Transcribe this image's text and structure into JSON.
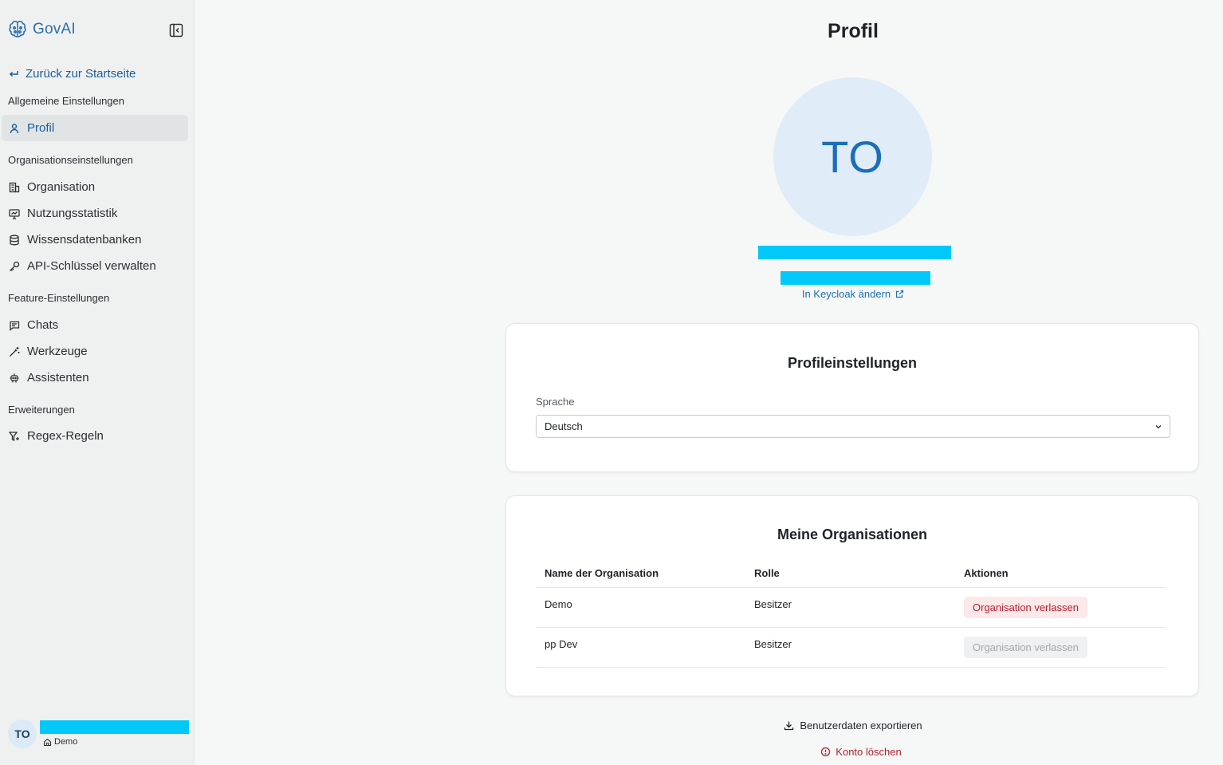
{
  "app": {
    "name": "GovAI"
  },
  "sidebar": {
    "back_label": "Zurück zur Startseite",
    "sections": {
      "general": "Allgemeine Einstellungen",
      "organization": "Organisationseinstellungen",
      "features": "Feature-Einstellungen",
      "extensions": "Erweiterungen"
    },
    "items": {
      "profile": "Profil",
      "organisation": "Organisation",
      "usage": "Nutzungsstatistik",
      "knowledge": "Wissensdatenbanken",
      "api_keys": "API-Schlüssel verwalten",
      "chats": "Chats",
      "tools": "Werkzeuge",
      "assistants": "Assistenten",
      "regex": "Regex-Regeln"
    },
    "user": {
      "initials": "TO",
      "org": "Demo"
    }
  },
  "main": {
    "title": "Profil",
    "avatar_initials": "TO",
    "keycloak_link": "In Keycloak ändern",
    "profile_settings": {
      "title": "Profileinstellungen",
      "language_label": "Sprache",
      "language_value": "Deutsch"
    },
    "organizations": {
      "title": "Meine Organisationen",
      "columns": {
        "name": "Name der Organisation",
        "role": "Rolle",
        "actions": "Aktionen"
      },
      "rows": [
        {
          "name": "Demo",
          "role": "Besitzer",
          "action": "Organisation verlassen",
          "enabled": true
        },
        {
          "name": "pp Dev",
          "role": "Besitzer",
          "action": "Organisation verlassen",
          "enabled": false
        }
      ]
    },
    "export_label": "Benutzerdaten exportieren",
    "delete_label": "Konto löschen"
  },
  "colors": {
    "accent": "#1b6fb8",
    "danger": "#b3202d",
    "redaction": "#00c8f8"
  }
}
